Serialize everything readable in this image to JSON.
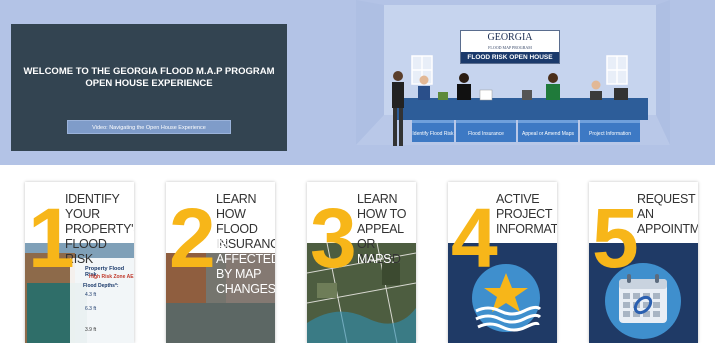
{
  "hero": {
    "welcome_title": "WELCOME TO THE GEORGIA FLOOD M.A.P PROGRAM OPEN HOUSE EXPERIENCE",
    "video_button": "Video: Navigating the Open House Experience",
    "sign_title": "GEORGIA",
    "sign_subtitle": "FLOOD MAP PROGRAM",
    "sign_banner": "FLOOD RISK OPEN HOUSE",
    "booths": [
      "Identify Flood Risk",
      "Flood Insurance",
      "Appeal or Amend Maps",
      "Project Information"
    ]
  },
  "cards": [
    {
      "number": "1",
      "text": "IDENTIFY YOUR PROPERTY'S FLOOD RISK",
      "image": "flood-risk-infographic",
      "inner_title": "Property Flood Risk",
      "inner_zone": "High Risk Zone AE",
      "inner_depth": "Flood Depths*:",
      "inner_values": [
        "4.3 ft",
        "6.3 ft",
        "3.9 ft"
      ]
    },
    {
      "number": "2",
      "text_dark": "LEARN HOW FLOOD INSURANCE",
      "text_light": "IS AFFECTED BY MAP CHANGES.",
      "image": "flooded-street-photo"
    },
    {
      "number": "3",
      "text_dark": "LEARN HOW TO APPEAL OR AMEND",
      "text_light": "MAPS.",
      "image": "aerial-map"
    },
    {
      "number": "4",
      "text": "ACTIVE PROJECT INFORMATION",
      "image": "star-waves-icon"
    },
    {
      "number": "5",
      "text": "REQUEST AN APPOINTMENT",
      "image": "calendar-icon"
    }
  ],
  "colors": {
    "hero_bg": "#b3c3e6",
    "panel": "#334451",
    "accent": "#f7b619",
    "booth": "#3d79c4",
    "dark_blue": "#1b3a6b"
  }
}
